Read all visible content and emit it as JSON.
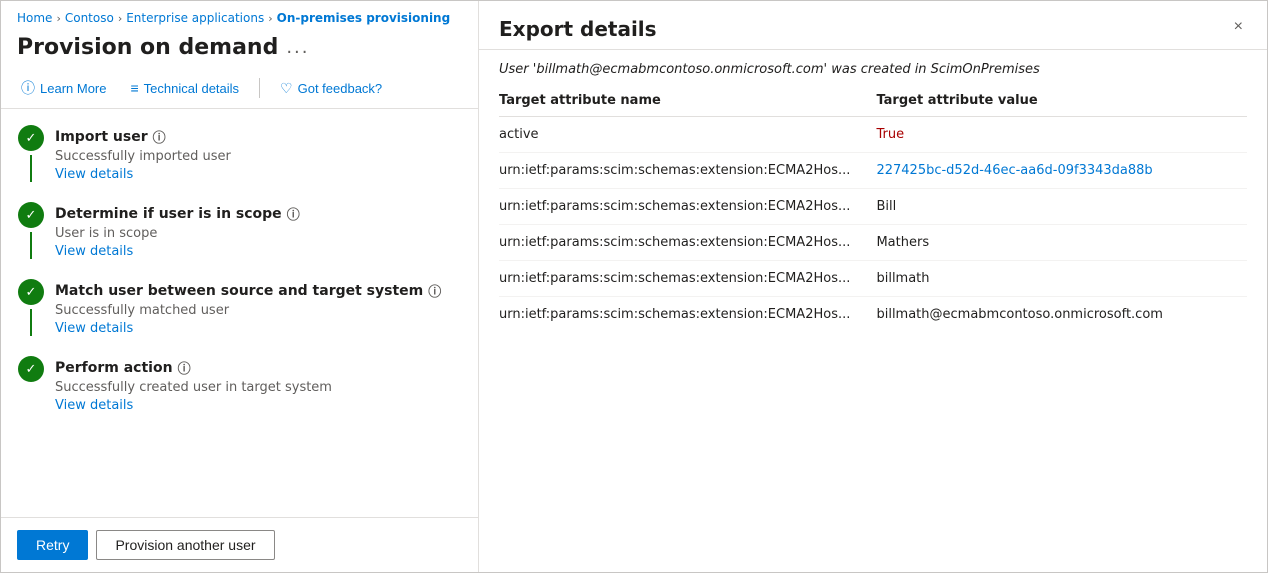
{
  "breadcrumb": {
    "items": [
      {
        "label": "Home",
        "link": true
      },
      {
        "label": "Contoso",
        "link": true
      },
      {
        "label": "Enterprise applications",
        "link": true
      },
      {
        "label": "On-premises provisioning",
        "link": true,
        "current": true
      }
    ]
  },
  "left": {
    "page_title": "Provision on demand",
    "more_options": "...",
    "toolbar": {
      "learn_more": "Learn More",
      "technical_details": "Technical details",
      "got_feedback": "Got feedback?"
    },
    "steps": [
      {
        "title": "Import user",
        "desc": "Successfully imported user",
        "link": "View details"
      },
      {
        "title": "Determine if user is in scope",
        "desc": "User is in scope",
        "link": "View details"
      },
      {
        "title": "Match user between source and target system",
        "desc": "Successfully matched user",
        "link": "View details"
      },
      {
        "title": "Perform action",
        "desc": "Successfully created user in target system",
        "link": "View details"
      }
    ],
    "actions": {
      "retry": "Retry",
      "provision_another": "Provision another user"
    }
  },
  "right": {
    "title": "Export details",
    "close_label": "×",
    "subtitle_prefix": "User ",
    "subtitle_user": "'billmath@ecmabmcontoso.onmicrosoft.com'",
    "subtitle_suffix": " was created in ScimOnPremises",
    "table": {
      "col_name": "Target attribute name",
      "col_value": "Target attribute value",
      "rows": [
        {
          "name": "active",
          "value": "True",
          "value_style": "red"
        },
        {
          "name": "urn:ietf:params:scim:schemas:extension:ECMA2Hos...",
          "value": "227425bc-d52d-46ec-aa6d-09f3343da88b",
          "value_style": "blue"
        },
        {
          "name": "urn:ietf:params:scim:schemas:extension:ECMA2Hos...",
          "value": "Bill",
          "value_style": "dark"
        },
        {
          "name": "urn:ietf:params:scim:schemas:extension:ECMA2Hos...",
          "value": "Mathers",
          "value_style": "dark"
        },
        {
          "name": "urn:ietf:params:scim:schemas:extension:ECMA2Hos...",
          "value": "billmath",
          "value_style": "dark"
        },
        {
          "name": "urn:ietf:params:scim:schemas:extension:ECMA2Hos...",
          "value": "billmath@ecmabmcontoso.onmicrosoft.com",
          "value_style": "dark"
        }
      ]
    }
  }
}
